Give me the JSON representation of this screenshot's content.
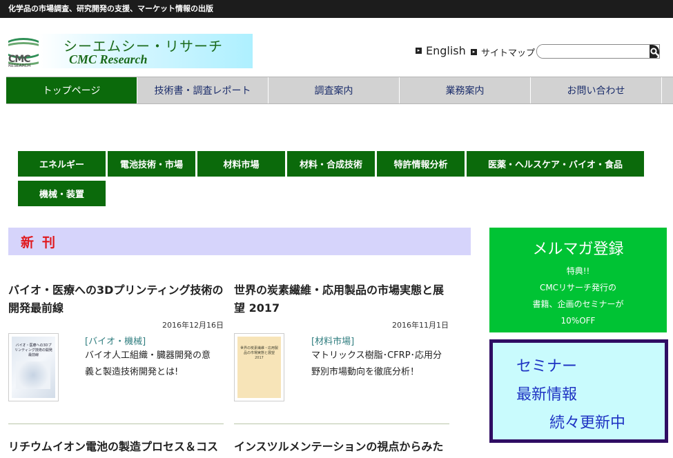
{
  "topbar": {
    "tagline": "化学品の市場調査、研究開発の支援、マーケット情報の出版"
  },
  "logo": {
    "mark_text": "CMC",
    "mark_sub": "RESEARCH",
    "jp": "シーエムシー・リサーチ",
    "en": "CMC Research"
  },
  "header": {
    "english": "English",
    "sitemap": "サイトマップ",
    "search_placeholder": ""
  },
  "nav": {
    "items": [
      "トップページ",
      "技術書・調査レポート",
      "調査案内",
      "業務案内",
      "お問い合わせ"
    ]
  },
  "categories": [
    "エネルギー",
    "電池技術・市場",
    "材料市場",
    "材料・合成技術",
    "特許情報分析",
    "医薬・ヘルスケア・バイオ・食品",
    "機械・装置"
  ],
  "new_section": {
    "heading": "新刊"
  },
  "books": [
    {
      "title_l1": "バイオ・医療への3Dプリンティング技術の",
      "title_l2": "開発最前線",
      "date": "2016年12月16日",
      "category": "[バイオ・機械]",
      "desc_l1": "バイオ人工組織・臓器開発の意",
      "desc_l2": "義と製造技術開発とは!",
      "thumb_text": "バイオ・医療への3Dプリンティング技術の開発最前線"
    },
    {
      "title_l1": "世界の炭素繊維・応用製品の市場実態と展",
      "title_l2": "望 2017",
      "date": "2016年11月1日",
      "category": "[材料市場]",
      "desc_l1": "マトリックス樹脂･CFRP･応用分",
      "desc_l2": "野別市場動向を徹底分析！",
      "thumb_text": "世界の炭素繊維・応用製品の市場実態と展望 2017"
    },
    {
      "title_l1": "リチウムイオン電池の製造プロセス＆コス"
    },
    {
      "title_l1": "インスツルメンテーションの視点からみた"
    }
  ],
  "mailmag": {
    "title": "メルマガ登録",
    "line1": "特典!!",
    "line2": "CMCリサーチ発行の",
    "line3": "書籍、企画のセミナーが",
    "line4": "10%OFF"
  },
  "seminar": {
    "line1": "セミナー",
    "line2": "最新情報",
    "line3": "続々更新中"
  },
  "colors": {
    "nav_active": "#0b6a0b",
    "category_bg": "#0b6a0b",
    "new_heading_bg": "#d6d4fb",
    "mailmag_bg": "#00c334",
    "seminar_bg": "#c9fbfd",
    "seminar_border": "#2f0d63"
  }
}
